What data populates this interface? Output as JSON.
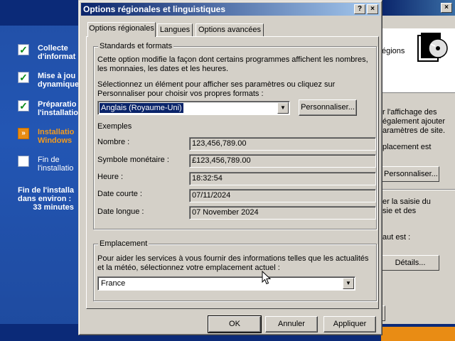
{
  "setup": {
    "steps": [
      {
        "text": "Collecte\nd'informat",
        "status": "done"
      },
      {
        "text": "Mise à jou\ndynamique",
        "status": "done"
      },
      {
        "text": "Préparatio\nl'installatio",
        "status": "done"
      },
      {
        "text": "Installatio\nWindows",
        "status": "current"
      },
      {
        "text": "Fin de\nl'installatio",
        "status": "todo"
      }
    ],
    "remaining": "Fin de l'installa\ndans environ :\n       33 minutes"
  },
  "background_dialog": {
    "header_text": "égions",
    "text1": "r l'affichage des\négalement ajouter\naramètres de site.",
    "text2": "placement est",
    "customize_button": "Personnaliser...",
    "text3": "er la saisie du\nsie et des",
    "text4": "aut est :",
    "details_button": "Détails..."
  },
  "dialog": {
    "title": "Options régionales et linguistiques",
    "help_button": "?",
    "close_button": "×",
    "tabs": [
      "Options régionales",
      "Langues",
      "Options avancées"
    ],
    "standards": {
      "label": "Standards et formats",
      "description": "Cette option modifie la façon dont certains programmes affichent les nombres,\nles monnaies, les dates et les heures.",
      "instruction": "Sélectionnez un élément pour afficher ses paramètres ou cliquez sur\nPersonnaliser pour choisir vos propres formats :",
      "selected_format": "Anglais (Royaume-Uni)",
      "customize_button": "Personnaliser...",
      "examples_label": "Exemples",
      "examples": [
        {
          "label": "Nombre :",
          "value": "123,456,789.00"
        },
        {
          "label": "Symbole monétaire :",
          "value": "£123,456,789.00"
        },
        {
          "label": "Heure :",
          "value": "18:32:54"
        },
        {
          "label": "Date courte :",
          "value": "07/11/2024"
        },
        {
          "label": "Date longue :",
          "value": "07 November 2024"
        }
      ]
    },
    "location": {
      "label": "Emplacement",
      "description": "Pour aider les services à vous fournir des informations telles que les actualités\net la météo, sélectionnez votre emplacement actuel :",
      "selected_location": "France"
    },
    "buttons": {
      "ok": "OK",
      "cancel": "Annuler",
      "apply": "Appliquer"
    }
  }
}
